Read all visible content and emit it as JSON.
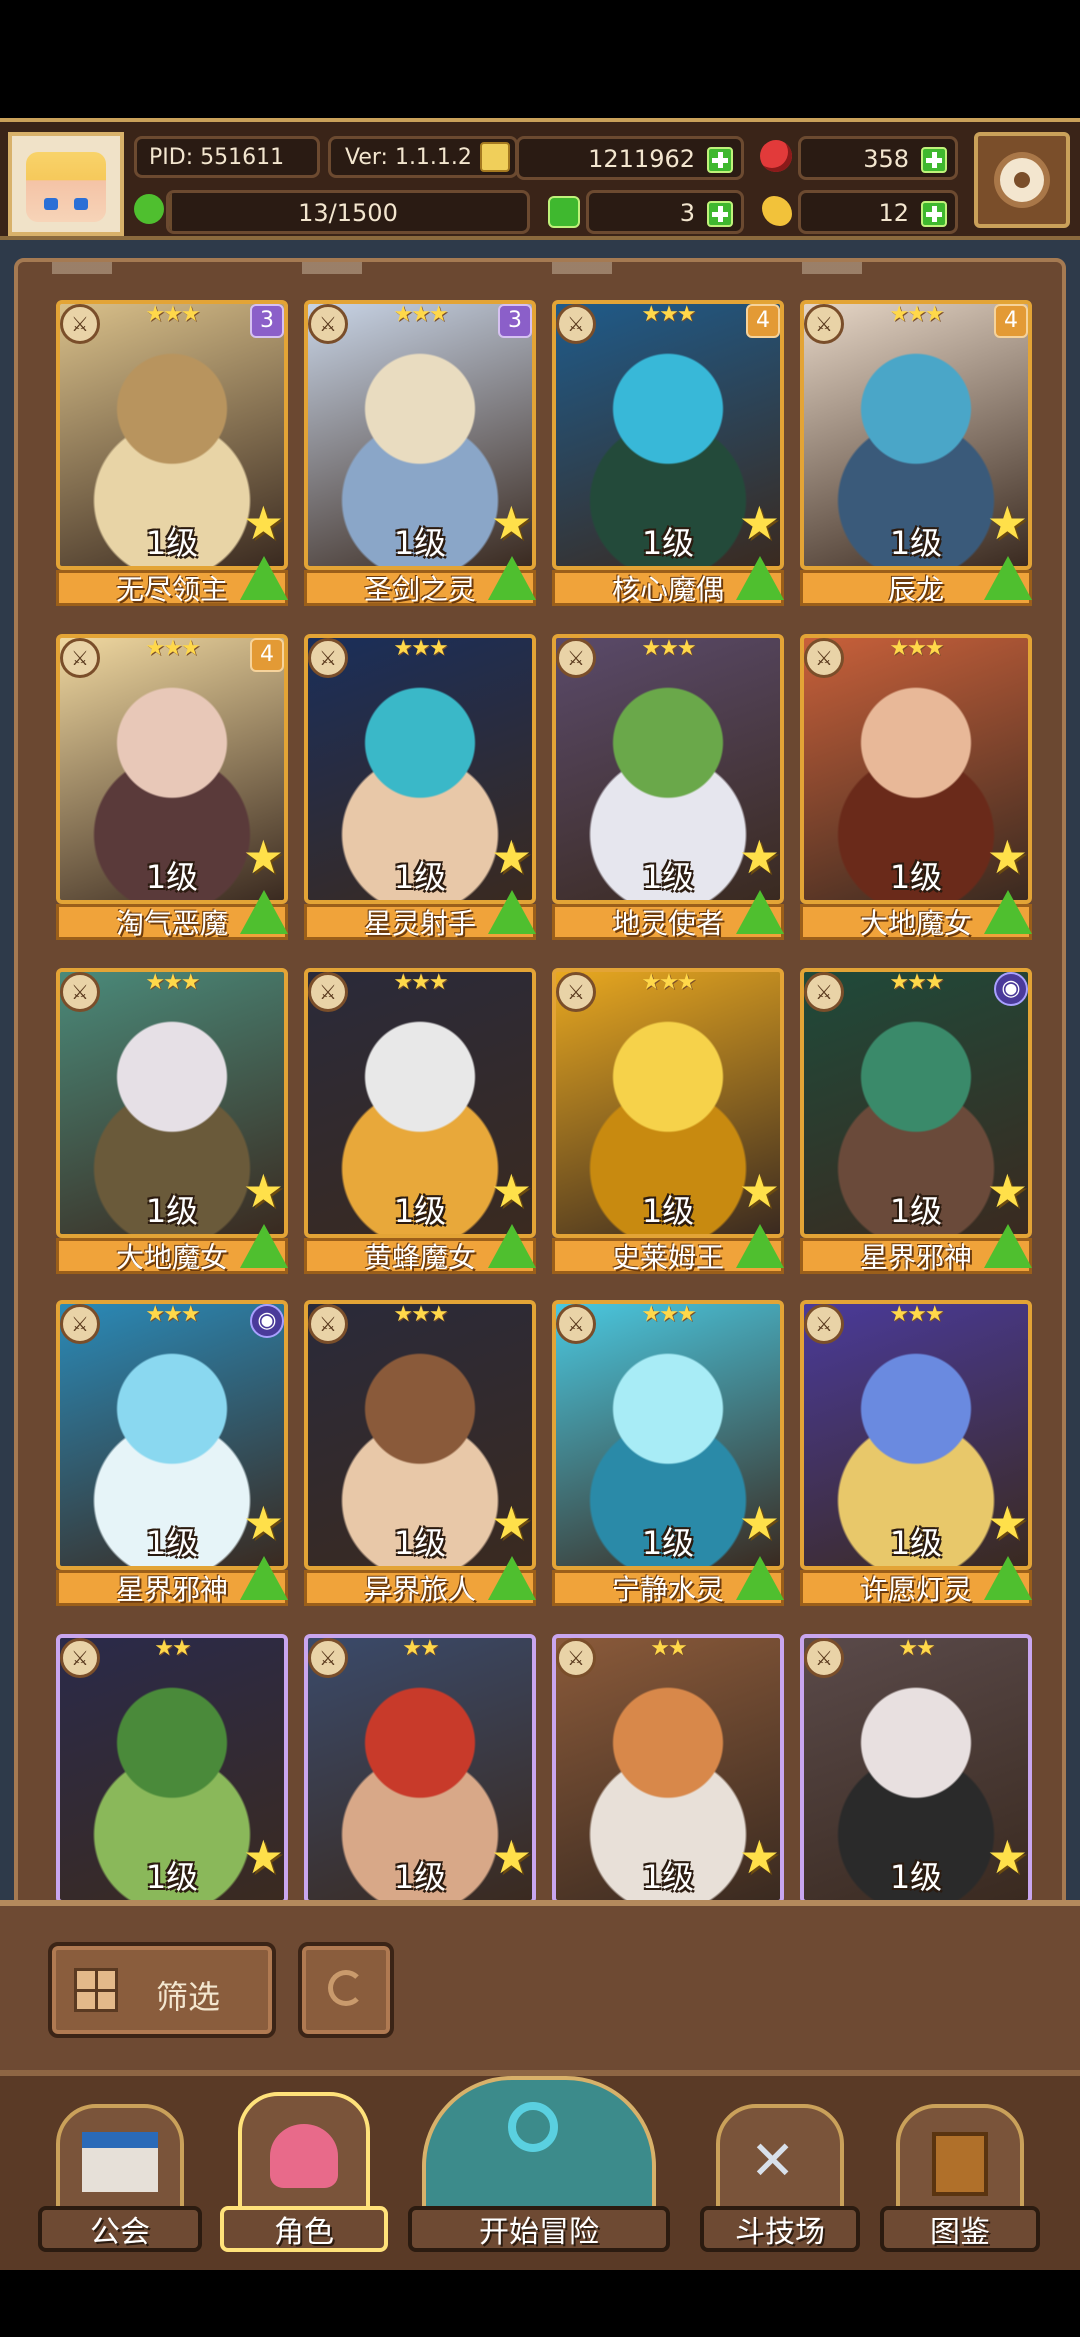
{
  "header": {
    "pid_label": "PID: 551611",
    "version_label": "Ver: 1.1.1.2",
    "exp": "13/1500",
    "exp_progress": 0.0087,
    "gold": "1211962",
    "gems": "358",
    "clover": "3",
    "meat": "12"
  },
  "cards": [
    {
      "name": "无尽领主",
      "level": "1级",
      "stars": "★★★",
      "badge": "3",
      "badge_color": "purple",
      "rarity": "gold",
      "colors": [
        "#d9c08a",
        "#b8945e",
        "#e8d4a6"
      ]
    },
    {
      "name": "圣剑之灵",
      "level": "1级",
      "stars": "★★★",
      "badge": "3",
      "badge_color": "purple",
      "rarity": "gold",
      "colors": [
        "#c8d4e6",
        "#e9dcc0",
        "#8aa6c8"
      ]
    },
    {
      "name": "核心魔偶",
      "level": "1级",
      "stars": "★★★",
      "badge": "4",
      "badge_color": "orange",
      "rarity": "gold",
      "colors": [
        "#1f5b8a",
        "#38b8d8",
        "#234a3a"
      ]
    },
    {
      "name": "辰龙",
      "level": "1级",
      "stars": "★★★",
      "badge": "4",
      "badge_color": "orange",
      "rarity": "gold",
      "colors": [
        "#e6d6c6",
        "#4aa6c8",
        "#3a5a7a"
      ]
    },
    {
      "name": "淘气恶魔",
      "level": "1级",
      "stars": "★★★",
      "badge": "4",
      "badge_color": "orange",
      "rarity": "gold",
      "colors": [
        "#f0d8a0",
        "#e8c8b8",
        "#5a3a3a"
      ]
    },
    {
      "name": "星灵射手",
      "level": "1级",
      "stars": "★★★",
      "badge": "",
      "badge_color": "",
      "rarity": "gold",
      "colors": [
        "#1a2e5a",
        "#3ab8c8",
        "#e8c8a8"
      ]
    },
    {
      "name": "地灵使者",
      "level": "1级",
      "stars": "★★★",
      "badge": "",
      "badge_color": "",
      "rarity": "gold",
      "colors": [
        "#5a4a6a",
        "#6aa84a",
        "#e6e6ee"
      ]
    },
    {
      "name": "大地魔女",
      "level": "1级",
      "stars": "★★★",
      "badge": "",
      "badge_color": "",
      "rarity": "gold",
      "colors": [
        "#c8603a",
        "#e8b898",
        "#6a2a1a"
      ]
    },
    {
      "name": "大地魔女",
      "level": "1级",
      "stars": "★★★",
      "badge": "",
      "badge_color": "",
      "rarity": "gold",
      "colors": [
        "#4a8a7a",
        "#e6e0e6",
        "#6a5a3a"
      ]
    },
    {
      "name": "黄蜂魔女",
      "level": "1级",
      "stars": "★★★",
      "badge": "",
      "badge_color": "",
      "rarity": "gold",
      "colors": [
        "#2a2a3a",
        "#e8e8e8",
        "#e8a83a"
      ]
    },
    {
      "name": "史莱姆王",
      "level": "1级",
      "stars": "★★★",
      "badge": "",
      "badge_color": "",
      "rarity": "gold",
      "colors": [
        "#e8a820",
        "#f6d24a",
        "#c88a10"
      ]
    },
    {
      "name": "星界邪神",
      "level": "1级",
      "stars": "★★★",
      "badge": "orb",
      "badge_color": "orb",
      "rarity": "gold",
      "colors": [
        "#1f4a3a",
        "#3a8a6a",
        "#6a4a3a"
      ]
    },
    {
      "name": "星界邪神",
      "level": "1级",
      "stars": "★★★",
      "badge": "orb",
      "badge_color": "orb",
      "rarity": "gold",
      "colors": [
        "#2a8ab8",
        "#8ad8f0",
        "#e6f4f8"
      ]
    },
    {
      "name": "异界旅人",
      "level": "1级",
      "stars": "★★★",
      "badge": "",
      "badge_color": "",
      "rarity": "gold",
      "colors": [
        "#2a2a3a",
        "#8a5a3a",
        "#e8c8a8"
      ]
    },
    {
      "name": "宁静水灵",
      "level": "1级",
      "stars": "★★★",
      "badge": "",
      "badge_color": "",
      "rarity": "gold",
      "colors": [
        "#4ac8e0",
        "#a8ecf6",
        "#2a8aa8"
      ]
    },
    {
      "name": "许愿灯灵",
      "level": "1级",
      "stars": "★★★",
      "badge": "",
      "badge_color": "",
      "rarity": "gold",
      "colors": [
        "#4a3a9a",
        "#6a8ae0",
        "#e8c86a"
      ]
    },
    {
      "name": "",
      "level": "1级",
      "stars": "★★",
      "badge": "",
      "badge_color": "",
      "rarity": "purple",
      "colors": [
        "#2a2a4a",
        "#4a8a3a",
        "#8ab85a"
      ]
    },
    {
      "name": "",
      "level": "1级",
      "stars": "★★",
      "badge": "",
      "badge_color": "",
      "rarity": "purple",
      "colors": [
        "#3a4a6a",
        "#c83a2a",
        "#d8a888"
      ]
    },
    {
      "name": "",
      "level": "1级",
      "stars": "★★",
      "badge": "",
      "badge_color": "",
      "rarity": "purple",
      "colors": [
        "#8a5a3a",
        "#d8884a",
        "#e8e0d8"
      ]
    },
    {
      "name": "",
      "level": "1级",
      "stars": "★★",
      "badge": "",
      "badge_color": "",
      "rarity": "purple",
      "colors": [
        "#5a4a4a",
        "#e8e0e0",
        "#2a2a2a"
      ]
    }
  ],
  "controls": {
    "filter_label": "筛选"
  },
  "nav": {
    "guild": "公会",
    "character": "角色",
    "adventure": "开始冒险",
    "arena": "斗技场",
    "codex": "图鉴"
  }
}
